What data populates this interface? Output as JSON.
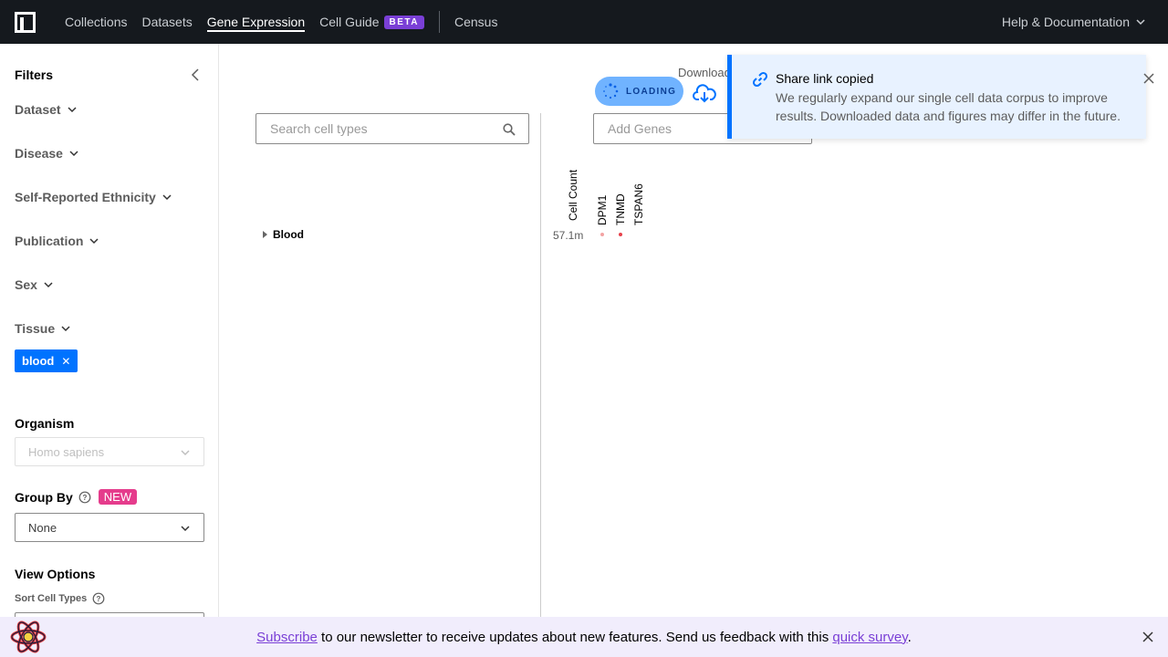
{
  "nav": {
    "logo": "czi-logo-icon",
    "links": [
      "Collections",
      "Datasets",
      "Gene Expression",
      "Cell Guide",
      "Census"
    ],
    "active": "Gene Expression",
    "beta_badge": "BETA",
    "help": "Help & Documentation"
  },
  "sidebar": {
    "filters_title": "Filters",
    "filters": [
      "Dataset",
      "Disease",
      "Self-Reported Ethnicity",
      "Publication",
      "Sex",
      "Tissue"
    ],
    "selected_tag": "blood",
    "organism": {
      "label": "Organism",
      "value": "Homo sapiens"
    },
    "group_by": {
      "label": "Group By",
      "badge": "NEW",
      "value": "None"
    },
    "view_options": {
      "label": "View Options",
      "sort_cell_types": "Sort Cell Types"
    }
  },
  "main": {
    "loading": "LOADING",
    "download": "Download",
    "search_cell_types": {
      "placeholder": "Search cell types"
    },
    "add_genes": {
      "placeholder": "Add Genes"
    },
    "tissue": "Blood",
    "columns": [
      "Cell Count",
      "DPM1",
      "TNMD",
      "TSPAN6"
    ],
    "cell_count_value": "57.1m",
    "dot_colors": [
      "#f3a3a3",
      "#e6414b"
    ]
  },
  "toast": {
    "title": "Share link copied",
    "body": "We regularly expand our single cell data corpus to improve results. Downloaded data and figures may differ in the future."
  },
  "banner": {
    "subscribe": "Subscribe",
    "text": " to our newsletter to receive updates about new features. Send us feedback with this ",
    "survey": "quick survey",
    "end": "."
  },
  "colors": {
    "nav_bg": "#15191e",
    "primary": "#0073ff",
    "beta": "#7a3fd6",
    "new_badge": "#e53c8c",
    "banner_bg": "#f1edfc"
  }
}
